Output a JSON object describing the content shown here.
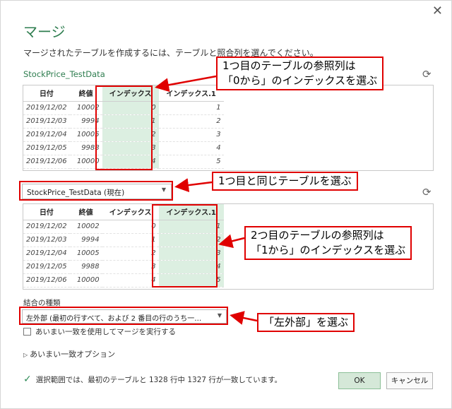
{
  "dialog": {
    "title": "マージ",
    "subtitle": "マージされたテーブルを作成するには、テーブルと照合列を選んでください。",
    "close_icon": "close-icon"
  },
  "table1": {
    "caption": "StockPrice_TestData",
    "columns": [
      "日付",
      "終値",
      "インデックス",
      "インデックス.1"
    ],
    "rows": [
      [
        "2019/12/02",
        "10002",
        "0",
        "1"
      ],
      [
        "2019/12/03",
        "9994",
        "1",
        "2"
      ],
      [
        "2019/12/04",
        "10005",
        "2",
        "3"
      ],
      [
        "2019/12/05",
        "9988",
        "3",
        "4"
      ],
      [
        "2019/12/06",
        "10000",
        "4",
        "5"
      ]
    ]
  },
  "table2": {
    "selected": "StockPrice_TestData (現在)",
    "columns": [
      "日付",
      "終値",
      "インデックス",
      "インデックス.1"
    ],
    "rows": [
      [
        "2019/12/02",
        "10002",
        "0",
        "1"
      ],
      [
        "2019/12/03",
        "9994",
        "1",
        "2"
      ],
      [
        "2019/12/04",
        "10005",
        "2",
        "3"
      ],
      [
        "2019/12/05",
        "9988",
        "3",
        "4"
      ],
      [
        "2019/12/06",
        "10000",
        "4",
        "5"
      ]
    ]
  },
  "join": {
    "label": "結合の種類",
    "selected": "左外部 (最初の行すべて、および 2 番目の行のうち一…",
    "fuzzy_checkbox": "あいまい一致を使用してマージを実行する",
    "fuzzy_options": "あいまい一致オプション"
  },
  "status": {
    "text": "選択範囲では、最初のテーブルと 1328 行中 1327 行が一致しています。"
  },
  "buttons": {
    "ok": "OK",
    "cancel": "キャンセル"
  },
  "callouts": {
    "c1_line1": "1つ目のテーブルの参照列は",
    "c1_line2": "「0から」のインデックスを選ぶ",
    "c2": "1つ目と同じテーブルを選ぶ",
    "c3_line1": "2つ目のテーブルの参照列は",
    "c3_line2": "「1から」のインデックスを選ぶ",
    "c4": "「左外部」を選ぶ"
  },
  "colors": {
    "accent": "#2e7d4f",
    "highlight": "#dcefe1",
    "annotation": "#e00000"
  }
}
